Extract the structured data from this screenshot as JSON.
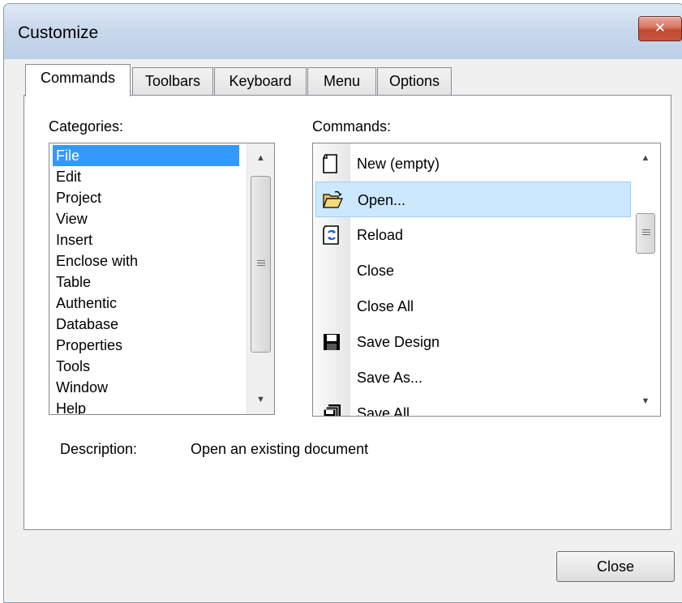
{
  "window": {
    "title": "Customize",
    "close_glyph": "✕"
  },
  "tabs": [
    {
      "label": "Commands",
      "active": true
    },
    {
      "label": "Toolbars",
      "active": false
    },
    {
      "label": "Keyboard",
      "active": false
    },
    {
      "label": "Menu",
      "active": false
    },
    {
      "label": "Options",
      "active": false
    }
  ],
  "categories": {
    "label": "Categories:",
    "items": [
      "File",
      "Edit",
      "Project",
      "View",
      "Insert",
      "Enclose with",
      "Table",
      "Authentic",
      "Database",
      "Properties",
      "Tools",
      "Window",
      "Help"
    ],
    "selected": "File"
  },
  "commands": {
    "label": "Commands:",
    "items": [
      {
        "label": "New (empty)",
        "icon": "new-document-icon"
      },
      {
        "label": "Open...",
        "icon": "open-folder-icon",
        "selected": true
      },
      {
        "label": "Reload",
        "icon": "reload-icon"
      },
      {
        "label": "Close",
        "icon": ""
      },
      {
        "label": "Close All",
        "icon": ""
      },
      {
        "label": "Save Design",
        "icon": "save-icon"
      },
      {
        "label": "Save As...",
        "icon": ""
      },
      {
        "label": "Save All",
        "icon": "save-all-icon"
      }
    ]
  },
  "description": {
    "label": "Description:",
    "value": "Open an existing document"
  },
  "buttons": {
    "close_label": "Close"
  },
  "colors": {
    "selection": "#3399ff",
    "hover_selection": "#cce8ff"
  }
}
